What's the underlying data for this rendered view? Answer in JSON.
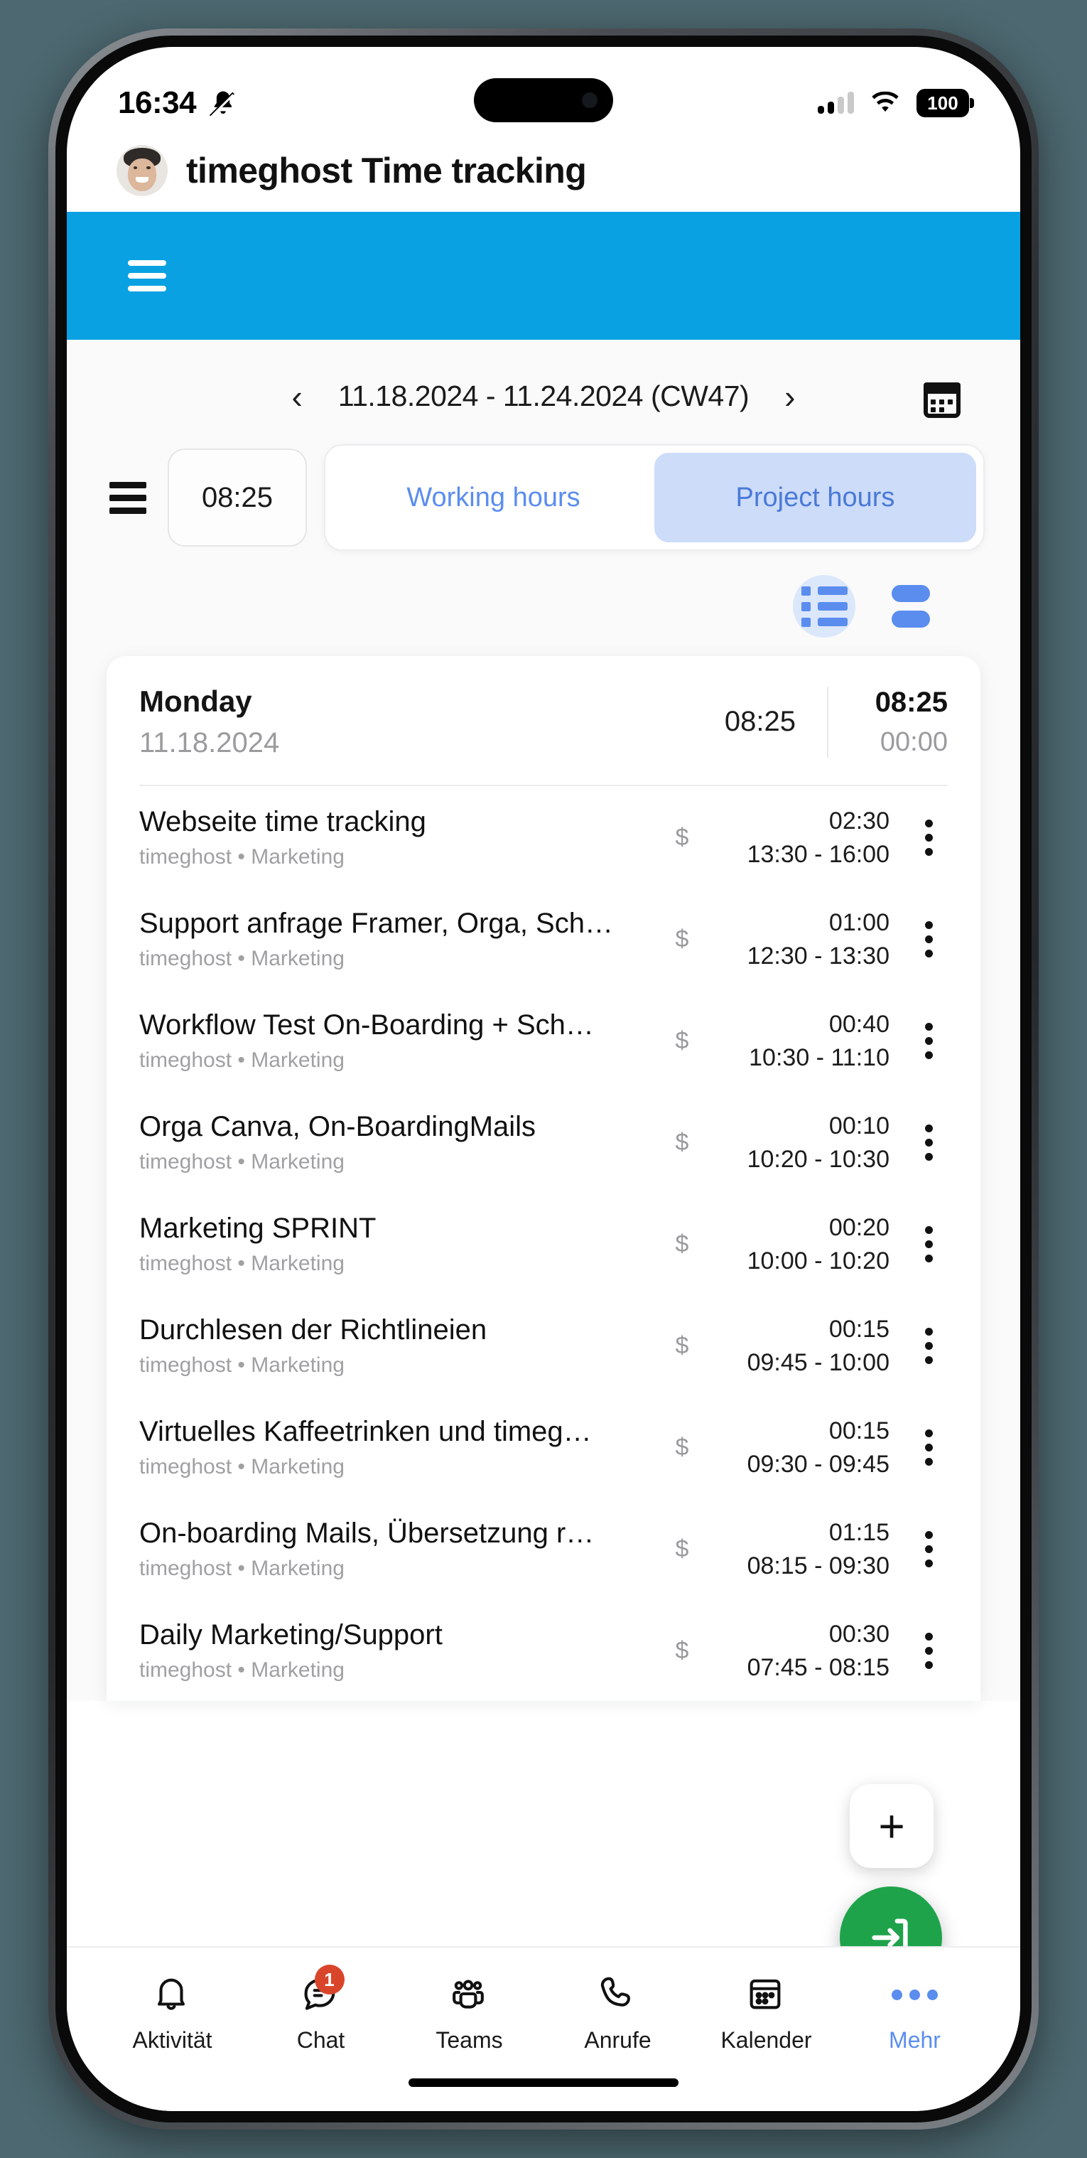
{
  "status_bar": {
    "time": "16:34",
    "mute_icon": "bell-muted-icon",
    "signal_icon": "cellular-signal-icon",
    "wifi_icon": "wifi-icon",
    "battery_level": "100"
  },
  "app_header": {
    "title": "timeghost Time tracking",
    "avatar": "user-avatar"
  },
  "blue_bar": {
    "menu_icon": "hamburger-menu-icon",
    "color": "#0aa1e2"
  },
  "date_nav": {
    "prev_label": "‹",
    "range": "11.18.2024 - 11.24.2024 (CW47)",
    "next_label": "›",
    "calendar_icon": "calendar-icon"
  },
  "toolbar": {
    "menu_icon": "list-menu-icon",
    "total_time": "08:25",
    "segments": [
      {
        "label": "Working hours",
        "active": false
      },
      {
        "label": "Project hours",
        "active": true
      }
    ]
  },
  "view_toggles": [
    {
      "icon": "list-view-icon",
      "active": true
    },
    {
      "icon": "bar-view-icon",
      "active": false
    }
  ],
  "day_card": {
    "day_name": "Monday",
    "date": "11.18.2024",
    "middle_total": "08:25",
    "right_total": "08:25",
    "right_secondary": "00:00"
  },
  "tasks": [
    {
      "title": "Webseite time tracking",
      "subtitle": "timeghost • Marketing",
      "duration": "02:30",
      "range": "13:30 - 16:00",
      "billable_icon": "dollar-icon",
      "menu_icon": "kebab-menu-icon"
    },
    {
      "title": "Support anfrage Framer, Orga, Sch…",
      "subtitle": "timeghost • Marketing",
      "duration": "01:00",
      "range": "12:30 - 13:30",
      "billable_icon": "dollar-icon",
      "menu_icon": "kebab-menu-icon"
    },
    {
      "title": "Workflow Test On-Boarding + Sch…",
      "subtitle": "timeghost • Marketing",
      "duration": "00:40",
      "range": "10:30 - 11:10",
      "billable_icon": "dollar-icon",
      "menu_icon": "kebab-menu-icon"
    },
    {
      "title": "Orga Canva, On-BoardingMails",
      "subtitle": "timeghost • Marketing",
      "duration": "00:10",
      "range": "10:20 - 10:30",
      "billable_icon": "dollar-icon",
      "menu_icon": "kebab-menu-icon"
    },
    {
      "title": "Marketing SPRINT",
      "subtitle": "timeghost • Marketing",
      "duration": "00:20",
      "range": "10:00 - 10:20",
      "billable_icon": "dollar-icon",
      "menu_icon": "kebab-menu-icon"
    },
    {
      "title": "Durchlesen der Richtlineien",
      "subtitle": "timeghost • Marketing",
      "duration": "00:15",
      "range": "09:45 - 10:00",
      "billable_icon": "dollar-icon",
      "menu_icon": "kebab-menu-icon"
    },
    {
      "title": "Virtuelles Kaffeetrinken und timeg…",
      "subtitle": "timeghost • Marketing",
      "duration": "00:15",
      "range": "09:30 - 09:45",
      "billable_icon": "dollar-icon",
      "menu_icon": "kebab-menu-icon"
    },
    {
      "title": "On-boarding Mails, Übersetzung r…",
      "subtitle": "timeghost • Marketing",
      "duration": "01:15",
      "range": "08:15 - 09:30",
      "billable_icon": "dollar-icon",
      "menu_icon": "kebab-menu-icon"
    },
    {
      "title": "Daily Marketing/Support",
      "subtitle": "timeghost • Marketing",
      "duration": "00:30",
      "range": "07:45 - 08:15",
      "billable_icon": "dollar-icon",
      "menu_icon": "kebab-menu-icon"
    }
  ],
  "fab": {
    "add_label": "+",
    "start_icon": "login-arrow-icon",
    "start_color": "#1ea34a"
  },
  "bottom_nav": [
    {
      "label": "Aktivität",
      "icon": "bell-icon",
      "active": false,
      "badge": ""
    },
    {
      "label": "Chat",
      "icon": "chat-bubble-icon",
      "active": false,
      "badge": "1"
    },
    {
      "label": "Teams",
      "icon": "teams-people-icon",
      "active": false,
      "badge": ""
    },
    {
      "label": "Anrufe",
      "icon": "phone-icon",
      "active": false,
      "badge": ""
    },
    {
      "label": "Kalender",
      "icon": "calendar-icon",
      "active": false,
      "badge": ""
    },
    {
      "label": "Mehr",
      "icon": "more-dots-icon",
      "active": true,
      "badge": ""
    }
  ]
}
